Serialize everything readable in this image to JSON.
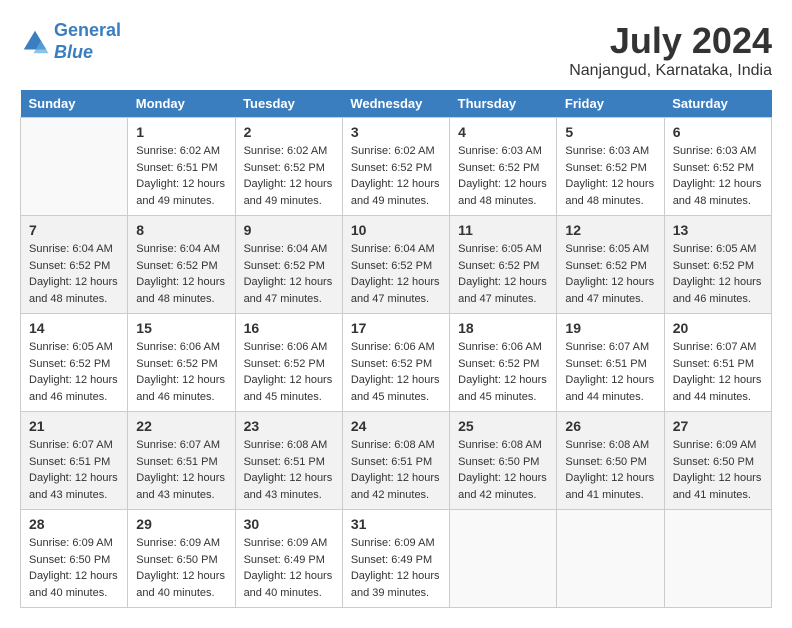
{
  "header": {
    "logo_line1": "General",
    "logo_line2": "Blue",
    "month_year": "July 2024",
    "location": "Nanjangud, Karnataka, India"
  },
  "days_of_week": [
    "Sunday",
    "Monday",
    "Tuesday",
    "Wednesday",
    "Thursday",
    "Friday",
    "Saturday"
  ],
  "weeks": [
    [
      {
        "day": "",
        "sunrise": "",
        "sunset": "",
        "daylight": ""
      },
      {
        "day": "1",
        "sunrise": "Sunrise: 6:02 AM",
        "sunset": "Sunset: 6:51 PM",
        "daylight": "Daylight: 12 hours and 49 minutes."
      },
      {
        "day": "2",
        "sunrise": "Sunrise: 6:02 AM",
        "sunset": "Sunset: 6:52 PM",
        "daylight": "Daylight: 12 hours and 49 minutes."
      },
      {
        "day": "3",
        "sunrise": "Sunrise: 6:02 AM",
        "sunset": "Sunset: 6:52 PM",
        "daylight": "Daylight: 12 hours and 49 minutes."
      },
      {
        "day": "4",
        "sunrise": "Sunrise: 6:03 AM",
        "sunset": "Sunset: 6:52 PM",
        "daylight": "Daylight: 12 hours and 48 minutes."
      },
      {
        "day": "5",
        "sunrise": "Sunrise: 6:03 AM",
        "sunset": "Sunset: 6:52 PM",
        "daylight": "Daylight: 12 hours and 48 minutes."
      },
      {
        "day": "6",
        "sunrise": "Sunrise: 6:03 AM",
        "sunset": "Sunset: 6:52 PM",
        "daylight": "Daylight: 12 hours and 48 minutes."
      }
    ],
    [
      {
        "day": "7",
        "sunrise": "Sunrise: 6:04 AM",
        "sunset": "Sunset: 6:52 PM",
        "daylight": "Daylight: 12 hours and 48 minutes."
      },
      {
        "day": "8",
        "sunrise": "Sunrise: 6:04 AM",
        "sunset": "Sunset: 6:52 PM",
        "daylight": "Daylight: 12 hours and 48 minutes."
      },
      {
        "day": "9",
        "sunrise": "Sunrise: 6:04 AM",
        "sunset": "Sunset: 6:52 PM",
        "daylight": "Daylight: 12 hours and 47 minutes."
      },
      {
        "day": "10",
        "sunrise": "Sunrise: 6:04 AM",
        "sunset": "Sunset: 6:52 PM",
        "daylight": "Daylight: 12 hours and 47 minutes."
      },
      {
        "day": "11",
        "sunrise": "Sunrise: 6:05 AM",
        "sunset": "Sunset: 6:52 PM",
        "daylight": "Daylight: 12 hours and 47 minutes."
      },
      {
        "day": "12",
        "sunrise": "Sunrise: 6:05 AM",
        "sunset": "Sunset: 6:52 PM",
        "daylight": "Daylight: 12 hours and 47 minutes."
      },
      {
        "day": "13",
        "sunrise": "Sunrise: 6:05 AM",
        "sunset": "Sunset: 6:52 PM",
        "daylight": "Daylight: 12 hours and 46 minutes."
      }
    ],
    [
      {
        "day": "14",
        "sunrise": "Sunrise: 6:05 AM",
        "sunset": "Sunset: 6:52 PM",
        "daylight": "Daylight: 12 hours and 46 minutes."
      },
      {
        "day": "15",
        "sunrise": "Sunrise: 6:06 AM",
        "sunset": "Sunset: 6:52 PM",
        "daylight": "Daylight: 12 hours and 46 minutes."
      },
      {
        "day": "16",
        "sunrise": "Sunrise: 6:06 AM",
        "sunset": "Sunset: 6:52 PM",
        "daylight": "Daylight: 12 hours and 45 minutes."
      },
      {
        "day": "17",
        "sunrise": "Sunrise: 6:06 AM",
        "sunset": "Sunset: 6:52 PM",
        "daylight": "Daylight: 12 hours and 45 minutes."
      },
      {
        "day": "18",
        "sunrise": "Sunrise: 6:06 AM",
        "sunset": "Sunset: 6:52 PM",
        "daylight": "Daylight: 12 hours and 45 minutes."
      },
      {
        "day": "19",
        "sunrise": "Sunrise: 6:07 AM",
        "sunset": "Sunset: 6:51 PM",
        "daylight": "Daylight: 12 hours and 44 minutes."
      },
      {
        "day": "20",
        "sunrise": "Sunrise: 6:07 AM",
        "sunset": "Sunset: 6:51 PM",
        "daylight": "Daylight: 12 hours and 44 minutes."
      }
    ],
    [
      {
        "day": "21",
        "sunrise": "Sunrise: 6:07 AM",
        "sunset": "Sunset: 6:51 PM",
        "daylight": "Daylight: 12 hours and 43 minutes."
      },
      {
        "day": "22",
        "sunrise": "Sunrise: 6:07 AM",
        "sunset": "Sunset: 6:51 PM",
        "daylight": "Daylight: 12 hours and 43 minutes."
      },
      {
        "day": "23",
        "sunrise": "Sunrise: 6:08 AM",
        "sunset": "Sunset: 6:51 PM",
        "daylight": "Daylight: 12 hours and 43 minutes."
      },
      {
        "day": "24",
        "sunrise": "Sunrise: 6:08 AM",
        "sunset": "Sunset: 6:51 PM",
        "daylight": "Daylight: 12 hours and 42 minutes."
      },
      {
        "day": "25",
        "sunrise": "Sunrise: 6:08 AM",
        "sunset": "Sunset: 6:50 PM",
        "daylight": "Daylight: 12 hours and 42 minutes."
      },
      {
        "day": "26",
        "sunrise": "Sunrise: 6:08 AM",
        "sunset": "Sunset: 6:50 PM",
        "daylight": "Daylight: 12 hours and 41 minutes."
      },
      {
        "day": "27",
        "sunrise": "Sunrise: 6:09 AM",
        "sunset": "Sunset: 6:50 PM",
        "daylight": "Daylight: 12 hours and 41 minutes."
      }
    ],
    [
      {
        "day": "28",
        "sunrise": "Sunrise: 6:09 AM",
        "sunset": "Sunset: 6:50 PM",
        "daylight": "Daylight: 12 hours and 40 minutes."
      },
      {
        "day": "29",
        "sunrise": "Sunrise: 6:09 AM",
        "sunset": "Sunset: 6:50 PM",
        "daylight": "Daylight: 12 hours and 40 minutes."
      },
      {
        "day": "30",
        "sunrise": "Sunrise: 6:09 AM",
        "sunset": "Sunset: 6:49 PM",
        "daylight": "Daylight: 12 hours and 40 minutes."
      },
      {
        "day": "31",
        "sunrise": "Sunrise: 6:09 AM",
        "sunset": "Sunset: 6:49 PM",
        "daylight": "Daylight: 12 hours and 39 minutes."
      },
      {
        "day": "",
        "sunrise": "",
        "sunset": "",
        "daylight": ""
      },
      {
        "day": "",
        "sunrise": "",
        "sunset": "",
        "daylight": ""
      },
      {
        "day": "",
        "sunrise": "",
        "sunset": "",
        "daylight": ""
      }
    ]
  ]
}
